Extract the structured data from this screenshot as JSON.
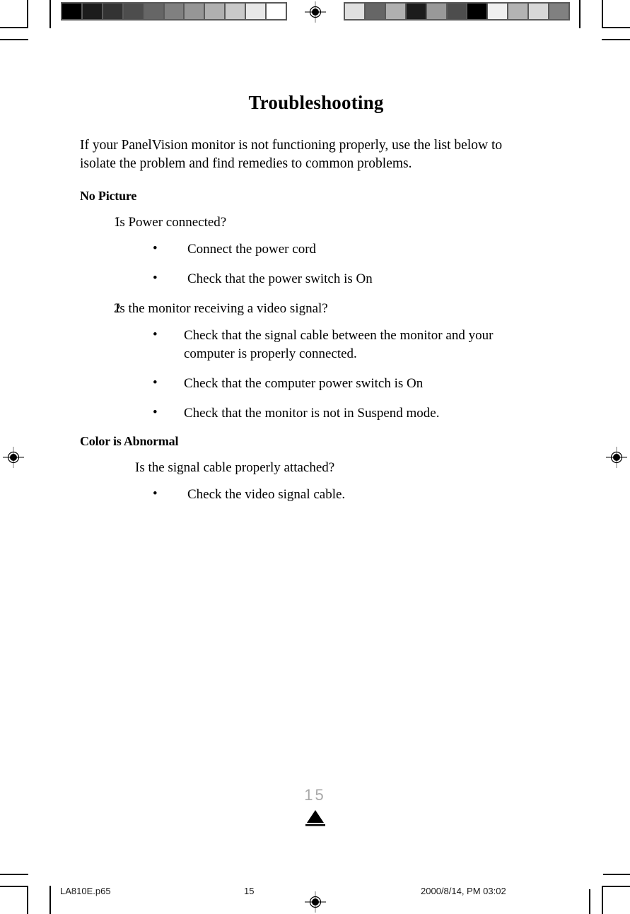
{
  "page": {
    "title": "Troubleshooting",
    "intro": "If your PanelVision monitor is not functioning properly, use the list below to isolate the problem and find remedies to common problems.",
    "folio_number": "15"
  },
  "sections": [
    {
      "heading": "No Picture",
      "items": [
        {
          "number": "1",
          "text": "Is Power connected?"
        },
        {
          "bullet": "•",
          "text": "Connect the power cord"
        },
        {
          "bullet": "•",
          "text": "Check that the power switch is On"
        },
        {
          "number": "2",
          "text": "Is the monitor receiving a video signal?"
        },
        {
          "bullet": "•",
          "text": "Check that the signal cable between the monitor and your computer is properly connected."
        },
        {
          "bullet": "•",
          "text": "Check that the computer power switch is On"
        },
        {
          "bullet": "•",
          "text": "Check that the monitor is not in Suspend mode."
        }
      ]
    },
    {
      "heading": "Color is Abnormal",
      "items": [
        {
          "text": "Is the signal cable properly attached?"
        },
        {
          "bullet": "•",
          "text": "Check the video signal cable."
        }
      ]
    }
  ],
  "content_lines": {
    "num_1_label": "1",
    "num_1_text": "Is Power connected?",
    "bullet_1_1": "Connect the power cord",
    "bullet_1_2": "Check that the power switch is On",
    "num_2_label": "2",
    "num_2_text": "Is the monitor receiving a video signal?",
    "bullet_2_1": "Check that the signal cable between the monitor and your computer is properly connected.",
    "bullet_2_2": "Check that the computer power switch is On",
    "bullet_2_3": "Check that the monitor is not in Suspend mode.",
    "plain_3_1": "Is the signal cable properly attached?",
    "bullet_3_1": "Check the video signal cable.",
    "heading_1": "No Picture",
    "heading_2": "Color is Abnormal",
    "bullet_glyph": "•"
  },
  "printer_marks": {
    "slug_filename": "LA810E.p65",
    "slug_page": "15",
    "slug_timestamp": "2000/8/14, PM 03:02",
    "registration_icon": "registration-target-icon",
    "crop_mark_icon": "crop-mark-icon",
    "triangle_icon": "folio-triangle-icon"
  },
  "calibration": {
    "strip_background": "#595959",
    "left_strip_label": "grayscale-ramp",
    "left_strip_patches": [
      "#000000",
      "#1c1c1c",
      "#333333",
      "#4d4d4d",
      "#666666",
      "#808080",
      "#969696",
      "#b0b0b0",
      "#c9c9c9",
      "#e8e8e8",
      "#ffffff"
    ],
    "right_strip_label": "grayscale-scrambled",
    "right_strip_patches": [
      "#e0e0e0",
      "#666666",
      "#b0b0b0",
      "#1c1c1c",
      "#999999",
      "#4d4d4d",
      "#000000",
      "#f0f0f0",
      "#b3b3b3",
      "#d8d8d8",
      "#808080"
    ]
  }
}
